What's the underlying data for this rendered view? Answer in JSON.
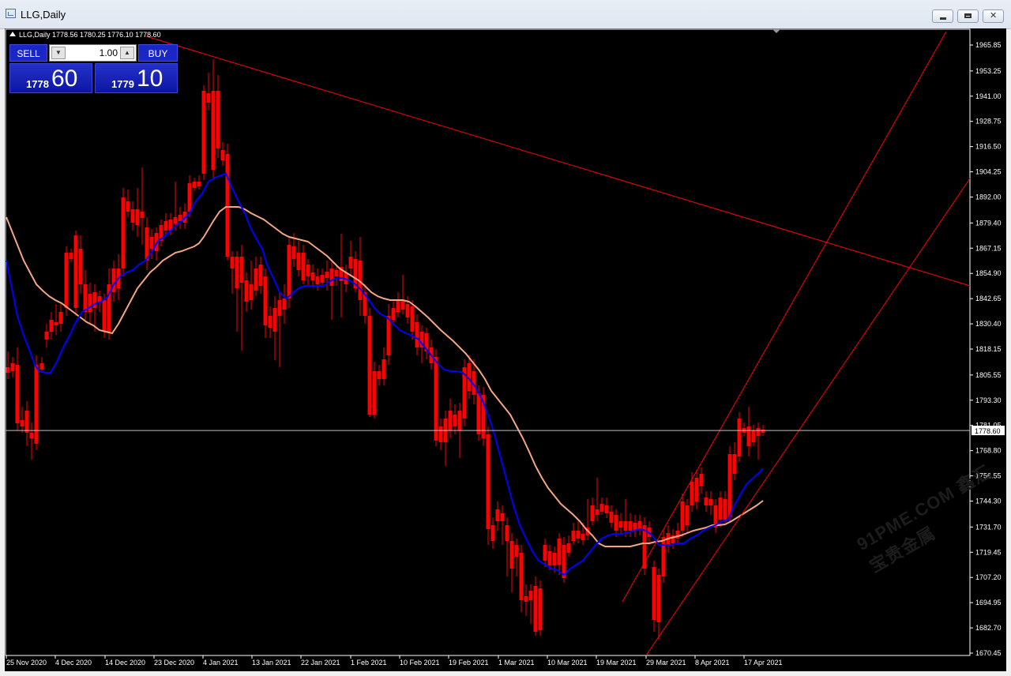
{
  "window": {
    "title": "LLG,Daily"
  },
  "chart_header": "LLG,Daily  1778.56 1780.25 1776.10 1778.60",
  "trade_panel": {
    "sell_label": "SELL",
    "buy_label": "BUY",
    "lot_value": "1.00",
    "sell_price_small": "1778",
    "sell_price_big": "60",
    "buy_price_small": "1779",
    "buy_price_big": "10"
  },
  "current_price_label": "1778.60",
  "price_axis_labels": [
    "1965.85",
    "1953.25",
    "1941.00",
    "1928.75",
    "1916.50",
    "1904.25",
    "1892.00",
    "1879.40",
    "1867.15",
    "1854.90",
    "1842.65",
    "1830.40",
    "1818.15",
    "1805.55",
    "1793.30",
    "1781.05",
    "1768.80",
    "1756.55",
    "1744.30",
    "1731.70",
    "1719.45",
    "1707.20",
    "1694.95",
    "1682.70",
    "1670.45"
  ],
  "date_axis_labels": [
    "25 Nov 2020",
    "4 Dec 2020",
    "14 Dec 2020",
    "23 Dec 2020",
    "4 Jan 2021",
    "13 Jan 2021",
    "22 Jan 2021",
    "1 Feb 2021",
    "10 Feb 2021",
    "19 Feb 2021",
    "1 Mar 2021",
    "10 Mar 2021",
    "19 Mar 2021",
    "29 Mar 2021",
    "8 Apr 2021",
    "17 Apr 2021"
  ],
  "watermark": "91PME.COM 鑫汇宝贵金属",
  "colors": {
    "bull": "#00ff00",
    "bear": "#ff0000",
    "ma_fast": "#0000ff",
    "ma_slow": "#f4a582",
    "trendline": "#ff0000",
    "price_line": "#c0c0c0"
  },
  "chart_data": {
    "type": "candlestick",
    "symbol": "LLG",
    "timeframe": "Daily",
    "ylim": [
      1670.45,
      1965.85
    ],
    "current_price": 1778.6
  }
}
